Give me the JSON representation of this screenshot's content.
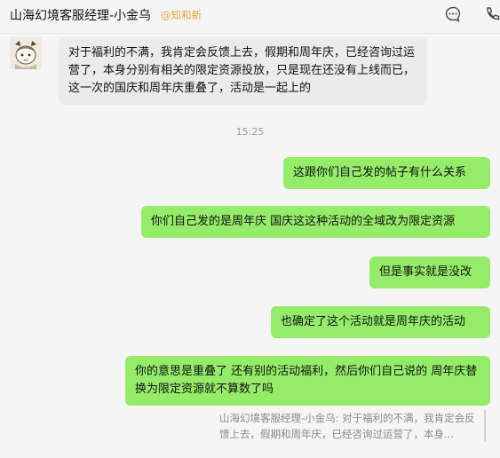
{
  "header": {
    "title": "山海幻境客服经理-小金乌",
    "tag": "@知和新",
    "icons": [
      "chat-more-icon",
      "phone-icon"
    ]
  },
  "messages": [
    {
      "side": "left",
      "text": "对于福利的不满，我肯定会反馈上去，假期和周年庆，已经咨询过运营了，本身分别有相关的限定资源投放，只是现在还没有上线而已，这一次的国庆和周年庆重叠了，活动是一起上的"
    },
    {
      "time": "15:25"
    },
    {
      "side": "right",
      "text": "这跟你们自己发的帖子有什么关系"
    },
    {
      "side": "right",
      "text": "你们自己发的是周年庆 国庆这这种活动的全域改为限定资源"
    },
    {
      "side": "right",
      "text": "但是事实就是没改"
    },
    {
      "side": "right",
      "text": "也确定了这个活动就是周年庆的活动"
    },
    {
      "side": "right",
      "text": "你的意思是重叠了 还有别的活动福利，然后你们自己说的 周年庆替换为限定资源就不算数了吗"
    }
  ],
  "quote": {
    "text": "山海幻境客服经理-小金乌: 对于福利的不满，我肯定会反馈上去，假期和周年庆，已经咨询过运营了，本身..."
  }
}
